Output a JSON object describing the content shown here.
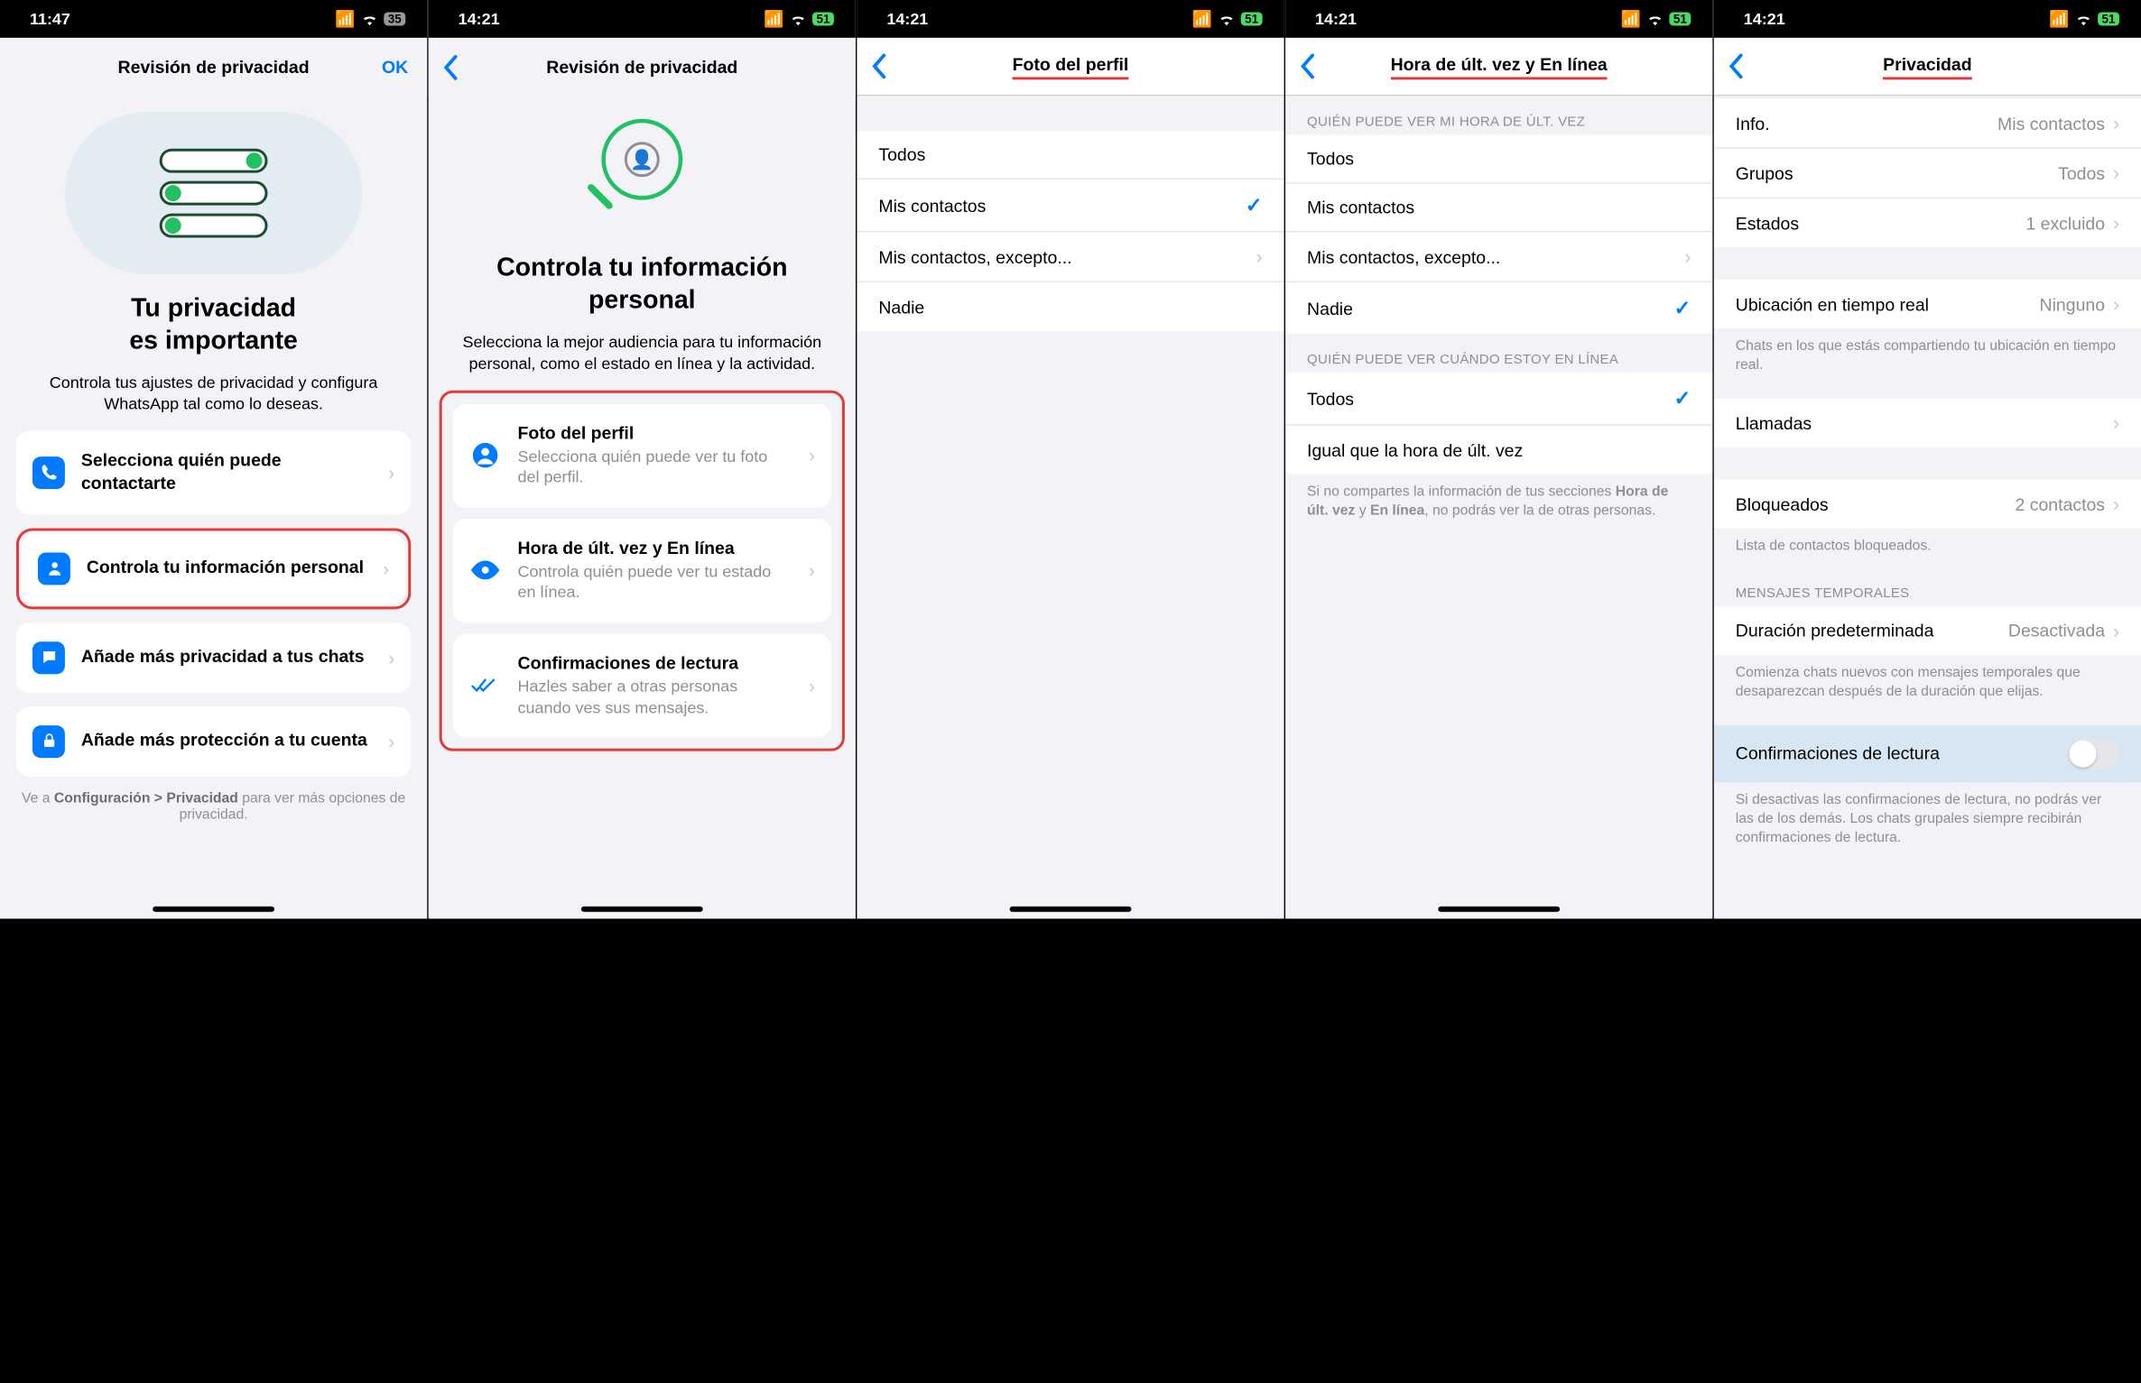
{
  "screen1": {
    "time": "11:47",
    "battery": "35",
    "nav_title": "Revisión de privacidad",
    "nav_ok": "OK",
    "hero_title_l1": "Tu privacidad",
    "hero_title_l2": "es importante",
    "hero_sub": "Controla tus ajustes de privacidad y configura WhatsApp tal como lo deseas.",
    "card1": "Selecciona quién puede contactarte",
    "card2": "Controla tu información personal",
    "card3": "Añade más privacidad a tus chats",
    "card4": "Añade más protección a tu cuenta",
    "footer_pre": "Ve a ",
    "footer_bold": "Configuración > Privacidad",
    "footer_post": " para ver más opciones de privacidad."
  },
  "screen2": {
    "time": "14:21",
    "battery": "51",
    "nav_title": "Revisión de privacidad",
    "hero_title_l1": "Controla tu información",
    "hero_title_l2": "personal",
    "hero_sub": "Selecciona la mejor audiencia para tu información personal, como el estado en línea y la actividad.",
    "c1_title": "Foto del perfil",
    "c1_sub": "Selecciona quién puede ver tu foto del perfil.",
    "c2_title": "Hora de últ. vez y En línea",
    "c2_sub": "Controla quién puede ver tu estado en línea.",
    "c3_title": "Confirmaciones de lectura",
    "c3_sub": "Hazles saber a otras personas cuando ves sus mensajes."
  },
  "screen3": {
    "time": "14:21",
    "battery": "51",
    "nav_title": "Foto del perfil",
    "r1": "Todos",
    "r2": "Mis contactos",
    "r3": "Mis contactos, excepto...",
    "r4": "Nadie"
  },
  "screen4": {
    "time": "14:21",
    "battery": "51",
    "nav_title": "Hora de últ. vez y En línea",
    "h1": "QUIÉN PUEDE VER MI HORA DE ÚLT. VEZ",
    "r1": "Todos",
    "r2": "Mis contactos",
    "r3": "Mis contactos, excepto...",
    "r4": "Nadie",
    "h2": "QUIÉN PUEDE VER CUÁNDO ESTOY EN LÍNEA",
    "r5": "Todos",
    "r6": "Igual que la hora de últ. vez",
    "foot_pre": "Si no compartes la información de tus secciones ",
    "foot_b1": "Hora de últ. vez",
    "foot_mid": " y ",
    "foot_b2": "En línea",
    "foot_post": ", no podrás ver la de otras personas."
  },
  "screen5": {
    "time": "14:21",
    "battery": "51",
    "nav_title": "Privacidad",
    "info_label": "Info.",
    "info_val": "Mis contactos",
    "grupos_label": "Grupos",
    "grupos_val": "Todos",
    "estados_label": "Estados",
    "estados_val": "1 excluido",
    "ubi_label": "Ubicación en tiempo real",
    "ubi_val": "Ninguno",
    "ubi_foot": "Chats en los que estás compartiendo tu ubicación en tiempo real.",
    "llamadas": "Llamadas",
    "bloq_label": "Bloqueados",
    "bloq_val": "2 contactos",
    "bloq_foot": "Lista de contactos bloqueados.",
    "temp_header": "MENSAJES TEMPORALES",
    "dur_label": "Duración predeterminada",
    "dur_val": "Desactivada",
    "dur_foot": "Comienza chats nuevos con mensajes temporales que desaparezcan después de la duración que elijas.",
    "conf_label": "Confirmaciones de lectura",
    "conf_foot": "Si desactivas las confirmaciones de lectura, no podrás ver las de los demás. Los chats grupales siempre recibirán confirmaciones de lectura."
  }
}
